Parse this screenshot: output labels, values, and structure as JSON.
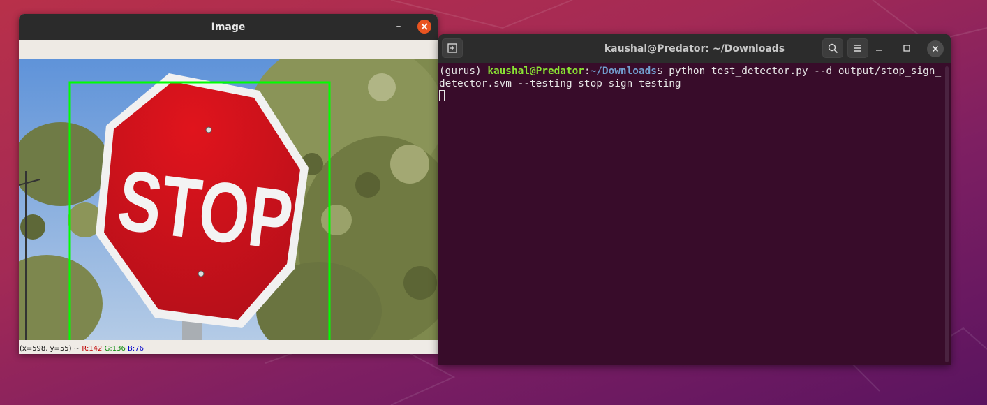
{
  "image_window": {
    "title": "Image",
    "status_bar": {
      "coords": "(x=598, y=55) ~",
      "r": "R:142",
      "g": "G:136",
      "b": "B:76"
    },
    "sign_text": "STOP",
    "bbox_color": "#00ff00"
  },
  "terminal_window": {
    "title": "kaushal@Predator: ~/Downloads",
    "prompt": {
      "env": "(gurus) ",
      "user_host": "kaushal@Predator",
      "sep": ":",
      "path": "~/Downloads",
      "symbol": "$ ",
      "command": "python test_detector.py --d output/stop_sign_detector.svm --testing stop_sign_testing"
    }
  },
  "colors": {
    "ubuntu_orange": "#e95420",
    "terminal_bg": "#380c2a",
    "prompt_user": "#8ae234",
    "prompt_path": "#729fcf"
  }
}
